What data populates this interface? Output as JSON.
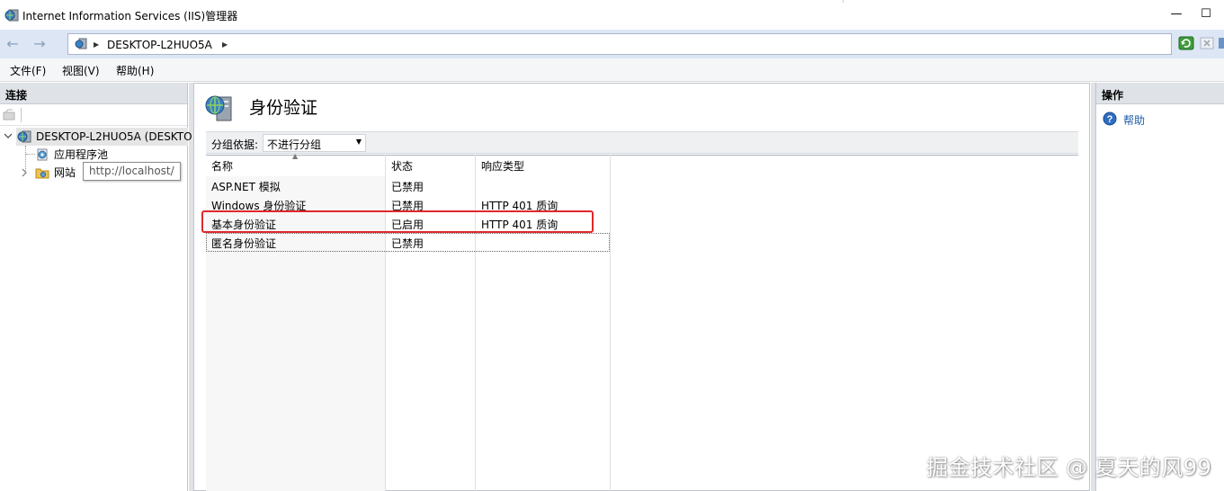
{
  "window": {
    "title": "Internet Information Services (IIS)管理器",
    "minimize_glyph": "—",
    "restore_glyph": "☐"
  },
  "address": {
    "crumbs": [
      "DESKTOP-L2HUO5A"
    ]
  },
  "menu": {
    "items": [
      "文件(F)",
      "视图(V)",
      "帮助(H)"
    ]
  },
  "connections": {
    "header": "连接",
    "tree": [
      {
        "label": "DESKTOP-L2HUO5A (DESKTO",
        "icon": "server-icon",
        "expanded": true,
        "selected": true
      },
      {
        "label": "应用程序池",
        "icon": "app-pool-icon"
      },
      {
        "label": "网站",
        "icon": "sites-folder-icon",
        "expanded": false
      }
    ],
    "tooltip": "http://localhost/"
  },
  "feature": {
    "title": "身份验证",
    "group_by_label": "分组依据:",
    "group_by_value": "不进行分组",
    "columns": [
      "名称",
      "状态",
      "响应类型"
    ],
    "rows": [
      {
        "name": "ASP.NET 模拟",
        "status": "已禁用",
        "response": ""
      },
      {
        "name": "Windows 身份验证",
        "status": "已禁用",
        "response": "HTTP 401 质询"
      },
      {
        "name": "基本身份验证",
        "status": "已启用",
        "response": "HTTP 401 质询"
      },
      {
        "name": "匿名身份验证",
        "status": "已禁用",
        "response": ""
      }
    ]
  },
  "actions": {
    "header": "操作",
    "items": [
      {
        "label": "帮助",
        "icon": "help-icon"
      }
    ]
  },
  "watermark": "掘金技术社区 @ 夏天的风99",
  "colors": {
    "highlight": "#e0282a",
    "link": "#1d5aa8",
    "panel_header": "#dfe3e8"
  }
}
